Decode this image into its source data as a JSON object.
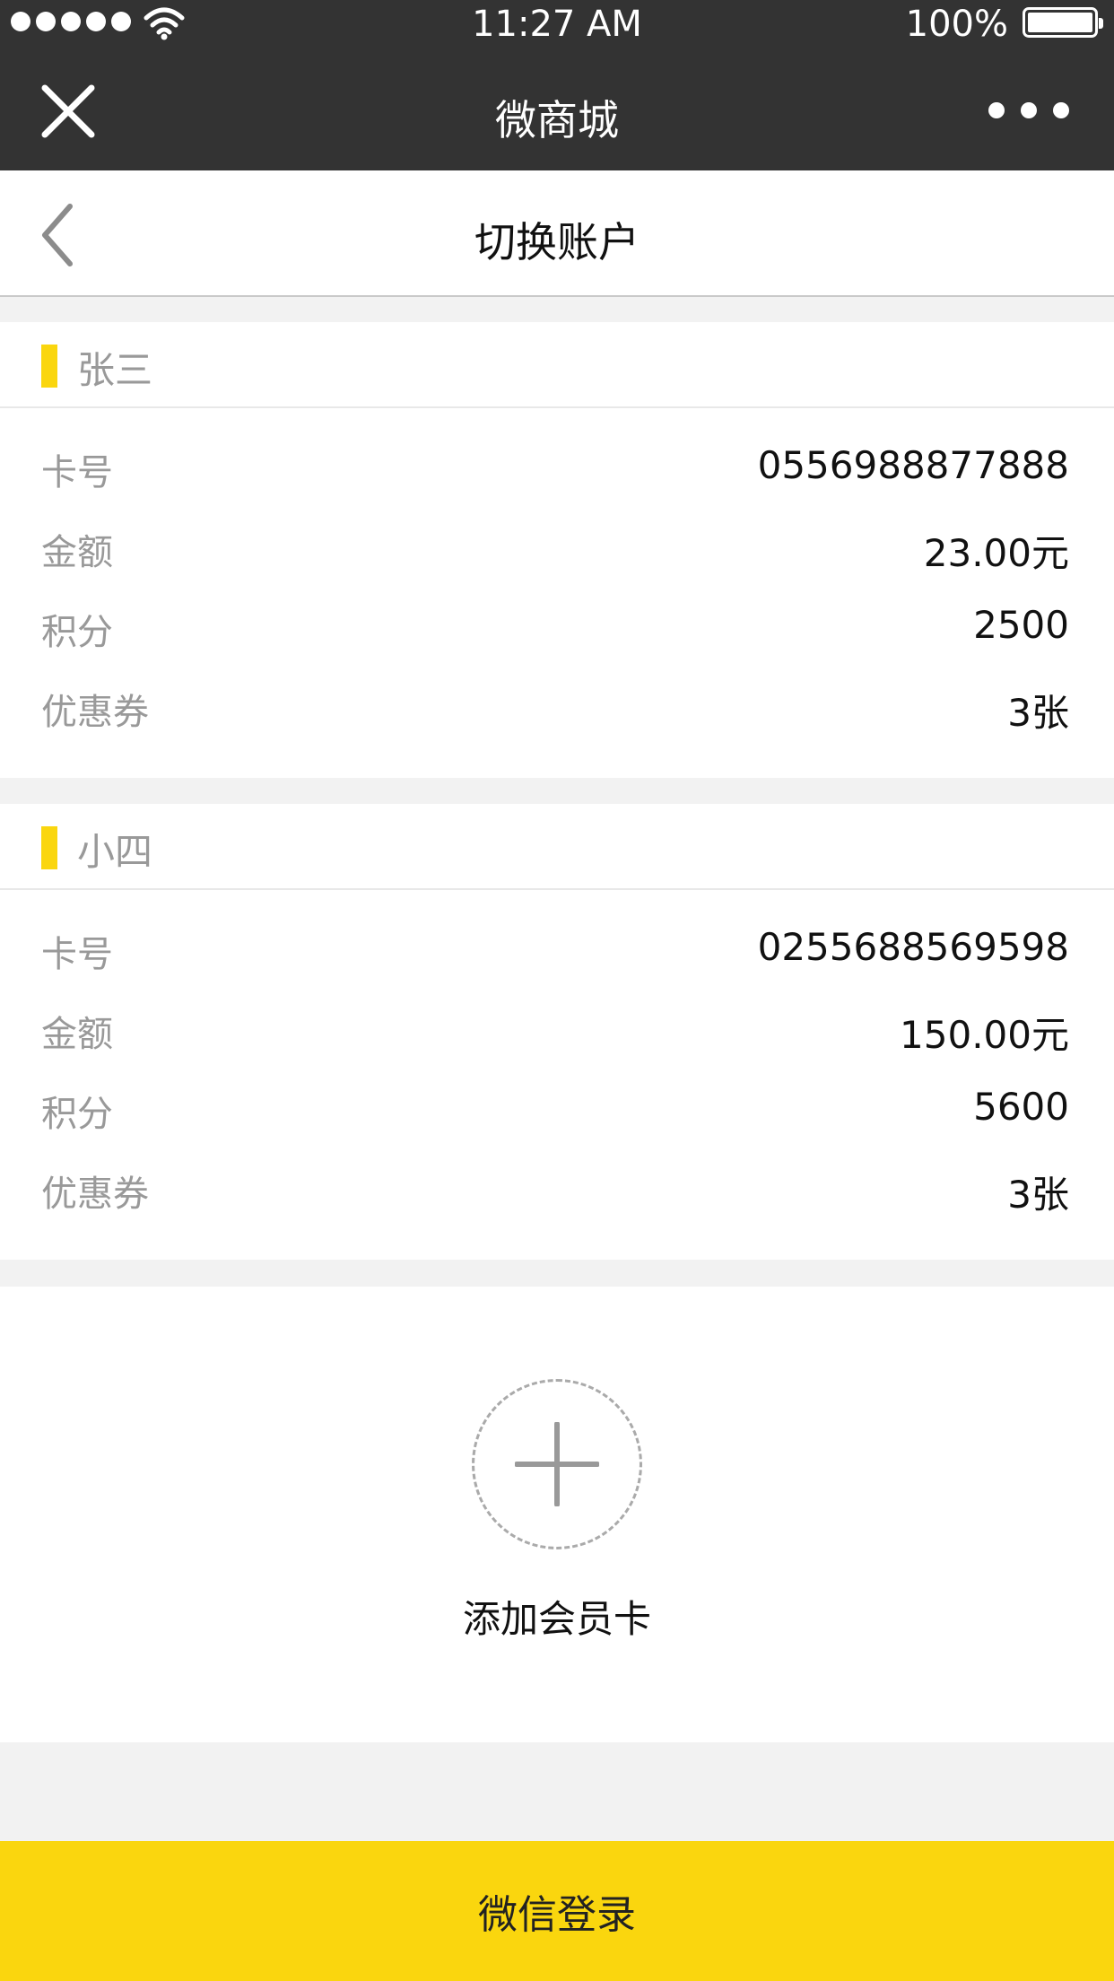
{
  "status_bar": {
    "time": "11:27 AM",
    "battery": "100%"
  },
  "app_bar": {
    "title": "微商城",
    "close_icon": "close-icon",
    "more_icon": "more-icon"
  },
  "nav": {
    "title": "切换账户",
    "back_icon": "back-icon"
  },
  "accounts": [
    {
      "name": "张三",
      "rows": [
        {
          "label": "卡号",
          "value": "0556988877888"
        },
        {
          "label": "金额",
          "value": "23.00元"
        },
        {
          "label": "积分",
          "value": "2500"
        },
        {
          "label": "优惠券",
          "value": "3张"
        }
      ]
    },
    {
      "name": "小四",
      "rows": [
        {
          "label": "卡号",
          "value": "0255688569598"
        },
        {
          "label": "金额",
          "value": "150.00元"
        },
        {
          "label": "积分",
          "value": "5600"
        },
        {
          "label": "优惠券",
          "value": "3张"
        }
      ]
    }
  ],
  "add_card": {
    "label": "添加会员卡",
    "icon": "plus-icon"
  },
  "login_button": {
    "label": "微信登录"
  },
  "colors": {
    "accent": "#fad60e",
    "header_bg": "#333333",
    "page_bg": "#f2f2f2"
  }
}
